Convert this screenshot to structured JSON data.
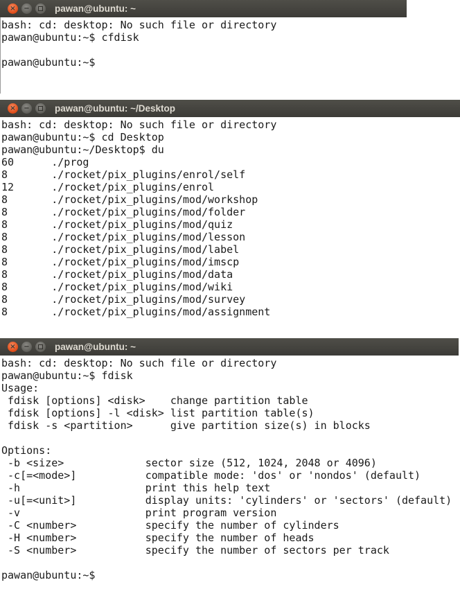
{
  "windows": [
    {
      "title": "pawan@ubuntu: ~",
      "lines": [
        "bash: cd: desktop: No such file or directory",
        "pawan@ubuntu:~$ cfdisk",
        "",
        "pawan@ubuntu:~$"
      ]
    },
    {
      "title": "pawan@ubuntu: ~/Desktop",
      "lines": [
        "bash: cd: desktop: No such file or directory",
        "pawan@ubuntu:~$ cd Desktop",
        "pawan@ubuntu:~/Desktop$ du",
        "60      ./prog",
        "8       ./rocket/pix_plugins/enrol/self",
        "12      ./rocket/pix_plugins/enrol",
        "8       ./rocket/pix_plugins/mod/workshop",
        "8       ./rocket/pix_plugins/mod/folder",
        "8       ./rocket/pix_plugins/mod/quiz",
        "8       ./rocket/pix_plugins/mod/lesson",
        "8       ./rocket/pix_plugins/mod/label",
        "8       ./rocket/pix_plugins/mod/imscp",
        "8       ./rocket/pix_plugins/mod/data",
        "8       ./rocket/pix_plugins/mod/wiki",
        "8       ./rocket/pix_plugins/mod/survey",
        "8       ./rocket/pix_plugins/mod/assignment"
      ]
    },
    {
      "title": "pawan@ubuntu: ~",
      "lines": [
        "bash: cd: desktop: No such file or directory",
        "pawan@ubuntu:~$ fdisk",
        "Usage:",
        " fdisk [options] <disk>    change partition table",
        " fdisk [options] -l <disk> list partition table(s)",
        " fdisk -s <partition>      give partition size(s) in blocks",
        "",
        "Options:",
        " -b <size>             sector size (512, 1024, 2048 or 4096)",
        " -c[=<mode>]           compatible mode: 'dos' or 'nondos' (default)",
        " -h                    print this help text",
        " -u[=<unit>]           display units: 'cylinders' or 'sectors' (default)",
        " -v                    print program version",
        " -C <number>           specify the number of cylinders",
        " -H <number>           specify the number of heads",
        " -S <number>           specify the number of sectors per track",
        "",
        "pawan@ubuntu:~$"
      ]
    }
  ],
  "controls": {
    "close": "×",
    "minimize": "−",
    "maximize": ""
  },
  "colors": {
    "titlebar": "#3c3b37",
    "title_text": "#dfdbd2",
    "close": "#df4a16",
    "terminal_bg": "#ffffff",
    "terminal_fg": "#1a1a1a"
  }
}
